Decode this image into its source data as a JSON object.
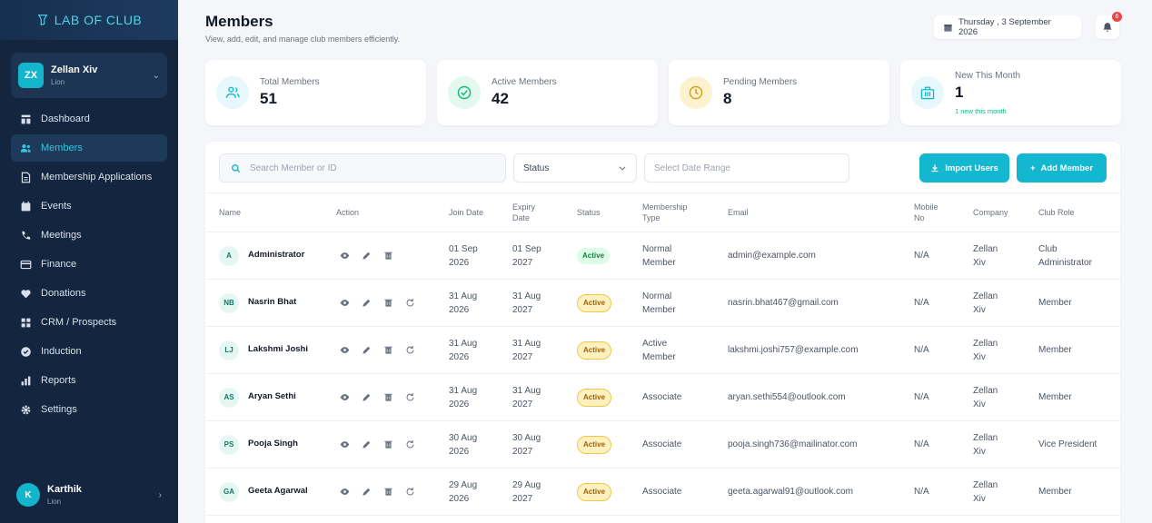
{
  "brand": {
    "name": "LAB OF CLUB"
  },
  "club_selector": {
    "initials": "ZX",
    "name": "Zellan Xiv",
    "sub": "Lion"
  },
  "nav": [
    {
      "label": "Dashboard",
      "icon": "dashboard-icon"
    },
    {
      "label": "Members",
      "icon": "members-icon",
      "active": true
    },
    {
      "label": "Membership Applications",
      "icon": "applications-icon"
    },
    {
      "label": "Events",
      "icon": "calendar-icon"
    },
    {
      "label": "Meetings",
      "icon": "phone-icon"
    },
    {
      "label": "Finance",
      "icon": "card-icon"
    },
    {
      "label": "Donations",
      "icon": "heart-icon"
    },
    {
      "label": "CRM / Prospects",
      "icon": "grid-icon"
    },
    {
      "label": "Induction",
      "icon": "check-circle-icon"
    },
    {
      "label": "Reports",
      "icon": "bar-chart-icon"
    },
    {
      "label": "Settings",
      "icon": "gear-icon"
    }
  ],
  "current_user": {
    "initial": "K",
    "name": "Karthik",
    "sub": "Lion"
  },
  "header": {
    "title": "Members",
    "subtitle": "View, add, edit, and manage club members efficiently.",
    "date": "Thursday , 3 September 2026",
    "notification_count": "6"
  },
  "stats": [
    {
      "label": "Total Members",
      "value": "51",
      "note": "",
      "color": "#e6f8fb",
      "icon_color": "#13b7cf",
      "icon": "users-icon"
    },
    {
      "label": "Active Members",
      "value": "42",
      "note": "",
      "color": "#e3f8ee",
      "icon_color": "#10b981",
      "icon": "check-circle-icon"
    },
    {
      "label": "Pending Members",
      "value": "8",
      "note": "",
      "color": "#fdf2cf",
      "icon_color": "#d4a014",
      "icon": "clock-icon"
    },
    {
      "label": "New This Month",
      "value": "1",
      "note": "1 new this month",
      "color": "#e6f8fb",
      "icon_color": "#13b7cf",
      "icon": "building-icon"
    }
  ],
  "filters": {
    "search_placeholder": "Search Member or ID",
    "status_label": "Status",
    "date_placeholder": "Select Date Range",
    "import_label": "Import Users",
    "add_label": "Add Member"
  },
  "columns": {
    "name": "Name",
    "action": "Action",
    "join": "Join Date",
    "expiry": "Expiry Date",
    "status": "Status",
    "type": "Membership Type",
    "email": "Email",
    "mobile": "Mobile No",
    "company": "Company",
    "role": "Club Role"
  },
  "rows": [
    {
      "initials": "A",
      "name": "Administrator",
      "join": "01 Sep 2026",
      "expiry": "01 Sep 2027",
      "status": "Active",
      "status_style": "green",
      "type": "Normal Member",
      "email": "admin@example.com",
      "mobile": "N/A",
      "company": "Zellan Xiv",
      "role": "Club Administrator",
      "renew": false
    },
    {
      "initials": "NB",
      "name": "Nasrin Bhat",
      "join": "31 Aug 2026",
      "expiry": "31 Aug 2027",
      "status": "Active",
      "status_style": "amber",
      "type": "Normal Member",
      "email": "nasrin.bhat467@gmail.com",
      "mobile": "N/A",
      "company": "Zellan Xiv",
      "role": "Member",
      "renew": true
    },
    {
      "initials": "LJ",
      "name": "Lakshmi Joshi",
      "join": "31 Aug 2026",
      "expiry": "31 Aug 2027",
      "status": "Active",
      "status_style": "amber",
      "type": "Active Member",
      "email": "lakshmi.joshi757@example.com",
      "mobile": "N/A",
      "company": "Zellan Xiv",
      "role": "Member",
      "renew": true
    },
    {
      "initials": "AS",
      "name": "Aryan Sethi",
      "join": "31 Aug 2026",
      "expiry": "31 Aug 2027",
      "status": "Active",
      "status_style": "amber",
      "type": "Associate",
      "email": "aryan.sethi554@outlook.com",
      "mobile": "N/A",
      "company": "Zellan Xiv",
      "role": "Member",
      "renew": true
    },
    {
      "initials": "PS",
      "name": "Pooja Singh",
      "join": "30 Aug 2026",
      "expiry": "30 Aug 2027",
      "status": "Active",
      "status_style": "amber",
      "type": "Associate",
      "email": "pooja.singh736@mailinator.com",
      "mobile": "N/A",
      "company": "Zellan Xiv",
      "role": "Vice President",
      "renew": true
    },
    {
      "initials": "GA",
      "name": "Geeta Agarwal",
      "join": "29 Aug 2026",
      "expiry": "29 Aug 2027",
      "status": "Active",
      "status_style": "amber",
      "type": "Associate",
      "email": "geeta.agarwal91@outlook.com",
      "mobile": "N/A",
      "company": "Zellan Xiv",
      "role": "Member",
      "renew": true
    }
  ]
}
